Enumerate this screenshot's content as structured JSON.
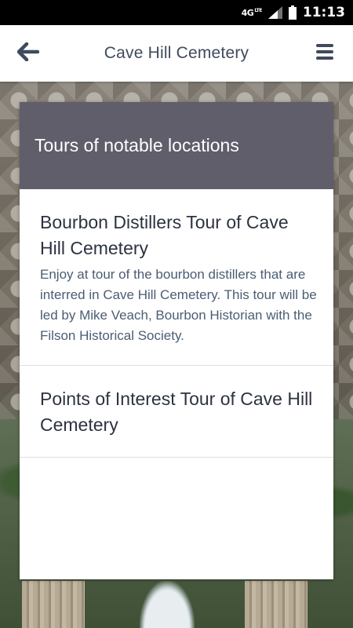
{
  "status_bar": {
    "network": "4G",
    "network_sub": "LTE",
    "time": "11:13",
    "icons": [
      "signal-icon",
      "battery-icon"
    ]
  },
  "app_bar": {
    "title": "Cave Hill Cemetery",
    "back_icon": "arrow-left-icon",
    "menu_icon": "hamburger-menu-icon"
  },
  "card": {
    "header_title": "Tours of notable locations",
    "tours": [
      {
        "title": "Bourbon Distillers Tour of Cave Hill Cemetery",
        "description": "Enjoy at tour of the bourbon distillers that are interred in Cave Hill Cemetery. This tour will be led by Mike Veach, Bourbon Historian with the Filson Historical Society."
      },
      {
        "title": "Points of Interest Tour of Cave Hill Cemetery",
        "description": ""
      }
    ]
  },
  "colors": {
    "header_bg": "#545260",
    "title_text": "#3f4a5e",
    "tour_title": "#2c3340",
    "tour_desc": "#4b5d73"
  }
}
